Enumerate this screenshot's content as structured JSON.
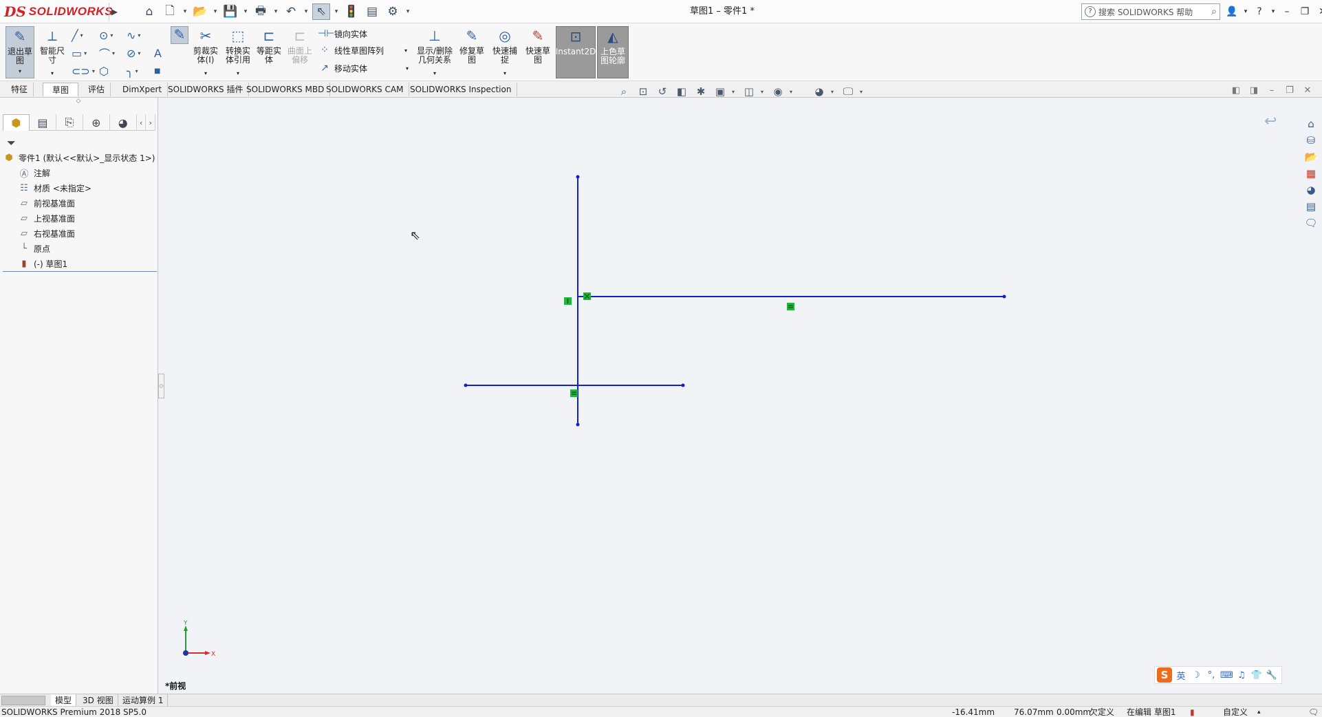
{
  "app": {
    "brand_ds": "DS",
    "brand_name": "SOLIDWORKS",
    "doc_title": "草图1 – 零件1 *"
  },
  "help_search": {
    "placeholder": "搜索 SOLIDWORKS 帮助"
  },
  "toolbar": {
    "exit_sketch": "退出草\n图",
    "smart_dimension": "智能尺\n寸",
    "trim_entities": "剪裁实\n体(I)",
    "convert_entities": "转换实\n体引用",
    "offset_entities": "等距实\n体",
    "offset_on_surface": "曲面上\n偏移",
    "mirror_entities": "镜向实体",
    "linear_pattern": "线性草图阵列",
    "move_entities": "移动实体",
    "display_delete_relations": "显示/删除\n几何关系",
    "repair_sketch": "修复草\n图",
    "quick_snaps": "快速捕\n捉",
    "rapid_sketch": "快速草\n图",
    "instant2d": "Instant2D",
    "shaded_contours": "上色草\n图轮廓"
  },
  "tabs": [
    {
      "label": "特征"
    },
    {
      "label": "草图"
    },
    {
      "label": "评估"
    },
    {
      "label": "DimXpert"
    },
    {
      "label": "SOLIDWORKS 插件"
    },
    {
      "label": "SOLIDWORKS MBD"
    },
    {
      "label": "SOLIDWORKS CAM"
    },
    {
      "label": "SOLIDWORKS Inspection"
    }
  ],
  "tree": {
    "root": "零件1  (默认<<默认>_显示状态 1>)",
    "items": [
      {
        "label": "注解"
      },
      {
        "label": "材质 <未指定>"
      },
      {
        "label": "前视基准面"
      },
      {
        "label": "上视基准面"
      },
      {
        "label": "右视基准面"
      },
      {
        "label": "原点"
      },
      {
        "label": "(-) 草图1"
      }
    ]
  },
  "view": {
    "label": "*前视",
    "axis_x": "X",
    "axis_y": "Y"
  },
  "ime": {
    "mode": "英"
  },
  "bottom_tabs": [
    {
      "label": "模型"
    },
    {
      "label": "3D 视图"
    },
    {
      "label": "运动算例 1"
    }
  ],
  "status": {
    "product": "SOLIDWORKS Premium 2018 SP5.0",
    "coord_x": "-16.41mm",
    "coord_y": "76.07mm",
    "coord_z": "0.00mm",
    "definition": "欠定义",
    "editing": "在编辑 草图1",
    "units": "自定义"
  },
  "colors": {
    "sketch_line": "#1020d0",
    "relation_icon": "#22b43c",
    "brand_red": "#d52027"
  }
}
